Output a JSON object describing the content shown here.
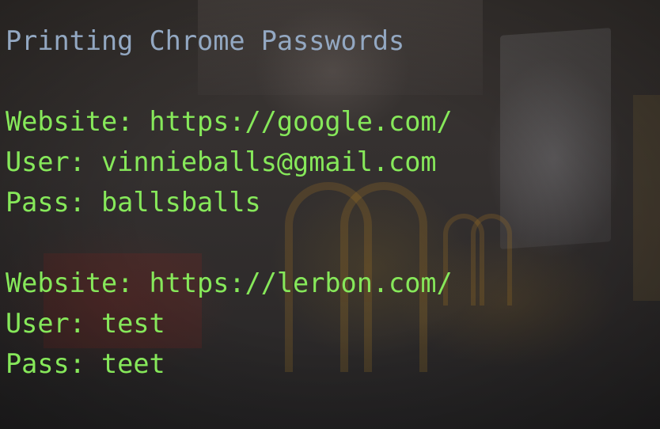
{
  "terminal": {
    "heading": "Printing Chrome Passwords",
    "entries": [
      {
        "website": "Website: https://google.com/",
        "user": "User: vinnieballs@gmail.com",
        "pass": "Pass: ballsballs"
      },
      {
        "website": "Website: https://lerbon.com/",
        "user": "User: test",
        "pass": "Pass: teet"
      }
    ]
  },
  "colors": {
    "heading_text": "#93a8c2",
    "output_text": "#86e85a",
    "background": "#2d2d2f"
  }
}
